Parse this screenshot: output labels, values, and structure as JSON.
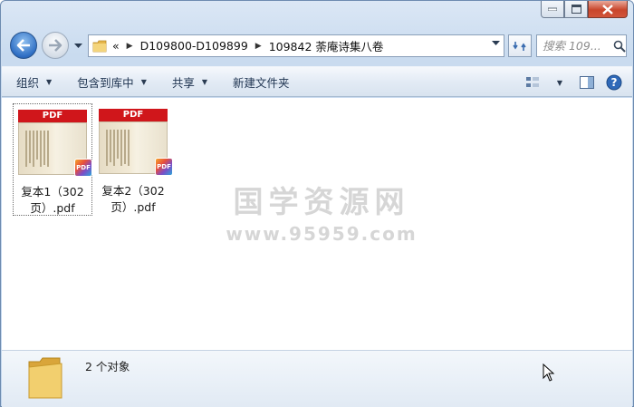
{
  "window": {
    "caption_buttons": [
      "minimize",
      "maximize",
      "close"
    ]
  },
  "address_bar": {
    "overflow": "«",
    "breadcrumbs": [
      "D109800-D109899",
      "109842 荼庵诗集八卷"
    ]
  },
  "search": {
    "placeholder": "搜索 109..."
  },
  "toolbar": {
    "organize": "组织",
    "include_library": "包含到库中",
    "share": "共享",
    "new_folder": "新建文件夹"
  },
  "files": [
    {
      "line1": "复本1（302",
      "line2": "页）.pdf",
      "badge": "PDF",
      "band": "PDF"
    },
    {
      "line1": "复本2（302",
      "line2": "页）.pdf",
      "badge": "PDF",
      "band": "PDF"
    }
  ],
  "watermark": {
    "title": "国学资源网",
    "url": "www.95959.com"
  },
  "details": {
    "count": "2 个对象"
  },
  "colors": {
    "pdf_red": "#d0161b",
    "window_frame": "#c2d6ed",
    "watermark": "#d6d6d6"
  }
}
